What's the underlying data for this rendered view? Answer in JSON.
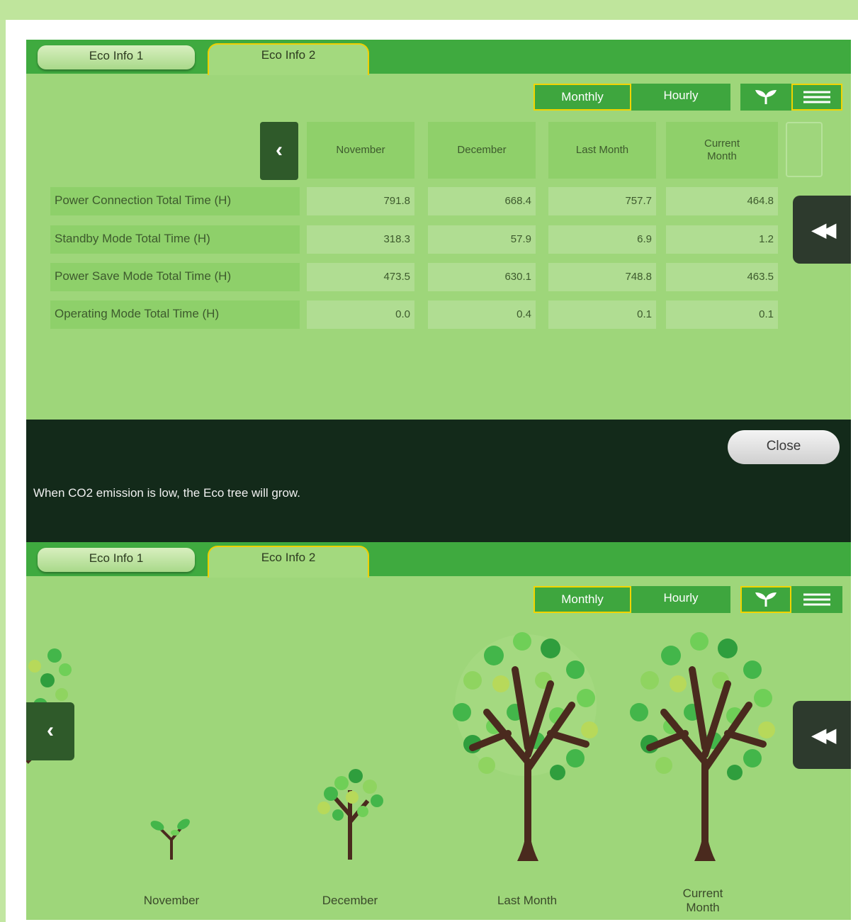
{
  "tabs": {
    "eco_info_1": "Eco Info 1",
    "eco_info_2": "Eco Info 2"
  },
  "period_buttons": {
    "monthly": "Monthly",
    "hourly": "Hourly"
  },
  "view_buttons": {
    "tree_icon": "tree-icon",
    "list_icon": "list-icon"
  },
  "table": {
    "columns": [
      "November",
      "December",
      "Last Month",
      "Current Month"
    ],
    "rows": [
      {
        "label": "Power Connection Total Time (H)",
        "values": [
          "791.8",
          "668.4",
          "757.7",
          "464.8"
        ]
      },
      {
        "label": "Standby Mode Total Time (H)",
        "values": [
          "318.3",
          "57.9",
          "6.9",
          "1.2"
        ]
      },
      {
        "label": "Power Save Mode Total Time (H)",
        "values": [
          "473.5",
          "630.1",
          "748.8",
          "463.5"
        ]
      },
      {
        "label": "Operating Mode Total Time (H)",
        "values": [
          "0.0",
          "0.4",
          "0.1",
          "0.1"
        ]
      }
    ]
  },
  "info": {
    "close_label": "Close",
    "message": "When CO2 emission is low, the Eco tree will grow."
  },
  "trees": {
    "labels": [
      "November",
      "December",
      "Last Month",
      "Current Month"
    ]
  },
  "colors": {
    "panel_green": "#9ed67a",
    "tab_bar_green": "#3faa3f",
    "selected_border": "#f2d400",
    "dark_band": "#132a1a"
  }
}
